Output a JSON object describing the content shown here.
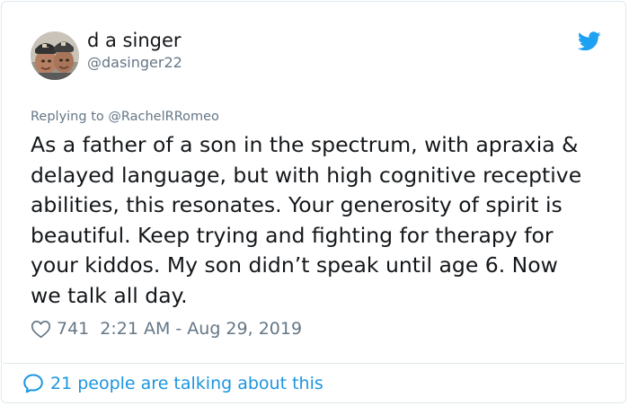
{
  "user": {
    "display_name": "d a singer",
    "handle": "@dasinger22",
    "avatar_icon": "profile-photo-avatar"
  },
  "reply": {
    "prefix": "Replying to ",
    "mention": "@RachelRRomeo"
  },
  "tweet": {
    "lines": [
      "As a father of a son in the spectrum, with apraxia &",
      "delayed language, but with high cognitive receptive",
      "abilities, this resonates. Your generosity of spirit is",
      "beautiful. Keep trying and fighting for therapy for",
      "your kiddos. My son didn’t speak until age 6. Now",
      "we talk all day."
    ]
  },
  "meta": {
    "likes": "741",
    "timestamp": "2:21 AM - Aug 29, 2019"
  },
  "footer": {
    "conversation_label": "21 people are talking about this"
  },
  "colors": {
    "brand_blue": "#1da1f2",
    "link_blue": "#1b95e0",
    "secondary_text": "#657786",
    "border": "#e1e8ed"
  },
  "icons": {
    "brand": "twitter-bird-icon",
    "like": "heart-outline-icon",
    "conversation": "speech-bubble-icon"
  }
}
